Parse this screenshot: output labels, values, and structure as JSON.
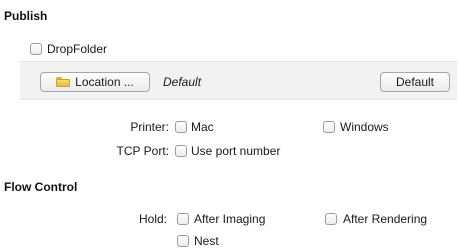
{
  "publish": {
    "title": "Publish",
    "dropfolder": {
      "label": "DropFolder",
      "checked": false,
      "location_button_label": "Location ...",
      "location_value": "Default",
      "default_button_label": "Default"
    },
    "printer": {
      "label": "Printer:",
      "mac_label": "Mac",
      "windows_label": "Windows"
    },
    "tcp_port": {
      "label": "TCP Port:",
      "use_port_label": "Use port number"
    }
  },
  "flow_control": {
    "title": "Flow Control",
    "hold": {
      "label": "Hold:",
      "after_imaging_label": "After Imaging",
      "after_rendering_label": "After Rendering",
      "nest_label": "Nest"
    }
  },
  "icons": {
    "folder": "folder-icon"
  }
}
